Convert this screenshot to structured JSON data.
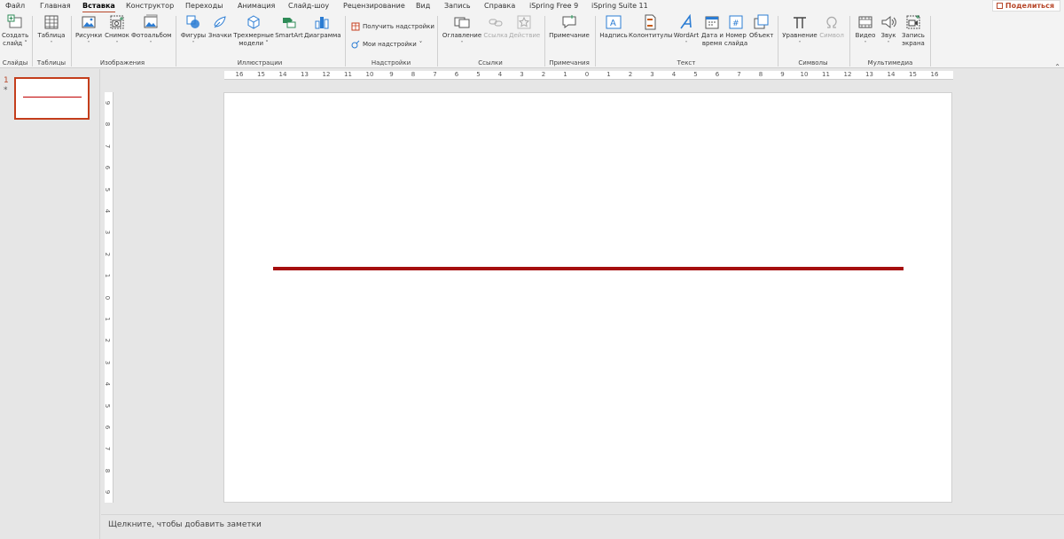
{
  "menu": {
    "tabs": [
      {
        "label": "Файл",
        "active": false
      },
      {
        "label": "Главная",
        "active": false
      },
      {
        "label": "Вставка",
        "active": true
      },
      {
        "label": "Конструктор",
        "active": false
      },
      {
        "label": "Переходы",
        "active": false
      },
      {
        "label": "Анимация",
        "active": false
      },
      {
        "label": "Слайд-шоу",
        "active": false
      },
      {
        "label": "Рецензирование",
        "active": false
      },
      {
        "label": "Вид",
        "active": false
      },
      {
        "label": "Запись",
        "active": false
      },
      {
        "label": "Справка",
        "active": false
      },
      {
        "label": "iSpring Free 9",
        "active": false
      },
      {
        "label": "iSpring Suite 11",
        "active": false
      }
    ],
    "share_label": "Поделиться"
  },
  "ribbon": {
    "create_slide": {
      "line1": "Создать",
      "line2": "слайд ˅"
    },
    "table": "Таблица",
    "pictures": "Рисунки",
    "screenshot": "Снимок",
    "photo_album": "Фотоальбом",
    "shapes": "Фигуры",
    "icons": "Значки",
    "models": {
      "line1": "Трехмерные",
      "line2": "модели ˅"
    },
    "smartart": "SmartArt",
    "chart": "Диаграмма",
    "get_addins": "Получить надстройки",
    "my_addins": "Мои надстройки",
    "toc": "Оглавление",
    "link": "Ссылка",
    "action": "Действие",
    "comment": "Примечание",
    "textbox": "Надпись",
    "header_footer": "Колонтитулы",
    "wordart": "WordArt",
    "datetime": {
      "line1": "Дата и",
      "line2": "время"
    },
    "slide_number": {
      "line1": "Номер",
      "line2": "слайда"
    },
    "object": "Объект",
    "equation": "Уравнение",
    "symbol": "Символ",
    "video": "Видео",
    "audio": "Звук",
    "screen_recording": {
      "line1": "Запись",
      "line2": "экрана"
    },
    "groups": {
      "slides": "Слайды",
      "tables": "Таблицы",
      "images": "Изображения",
      "illustrations": "Иллюстрации",
      "addins": "Надстройки",
      "links": "Ссылки",
      "comments": "Примечания",
      "text": "Текст",
      "symbols": "Символы",
      "media": "Мультимедиа"
    }
  },
  "thumbnails": {
    "slide_number": "1",
    "star": "*"
  },
  "rulers": {
    "horizontal": [
      "16",
      "15",
      "14",
      "13",
      "12",
      "11",
      "10",
      "9",
      "8",
      "7",
      "6",
      "5",
      "4",
      "3",
      "2",
      "1",
      "0",
      "1",
      "2",
      "3",
      "4",
      "5",
      "6",
      "7",
      "8",
      "9",
      "10",
      "11",
      "12",
      "13",
      "14",
      "15",
      "16"
    ],
    "vertical": [
      "9",
      "8",
      "7",
      "6",
      "5",
      "4",
      "3",
      "2",
      "1",
      "0",
      "1",
      "2",
      "3",
      "4",
      "5",
      "6",
      "7",
      "8",
      "9"
    ]
  },
  "slide": {
    "line_color": "#a50e0e"
  },
  "notes": {
    "placeholder": "Щелкните, чтобы добавить заметки"
  },
  "colors": {
    "accent": "#b7472a"
  }
}
